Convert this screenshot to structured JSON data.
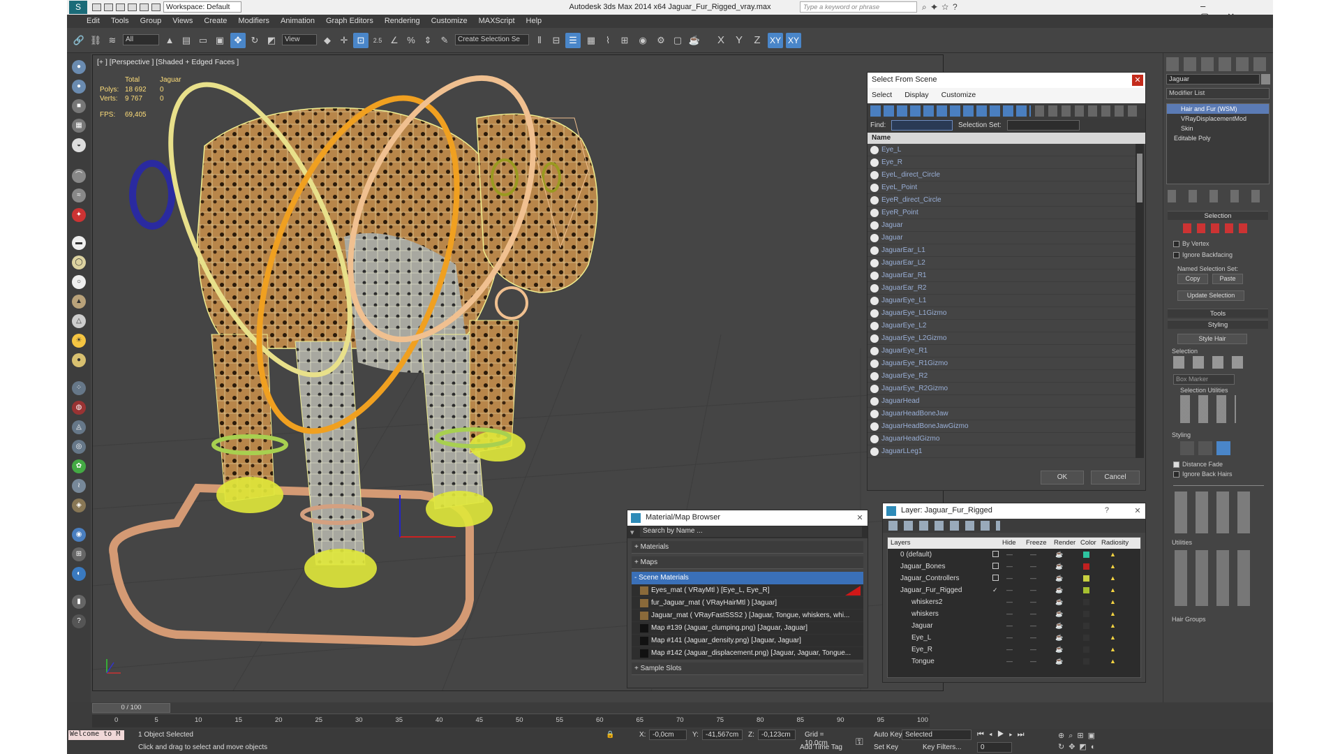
{
  "window": {
    "title": "Autodesk 3ds Max  2014 x64    Jaguar_Fur_Rigged_vray.max",
    "workspace": "Workspace: Default",
    "search_placeholder": "Type a keyword or phrase"
  },
  "menu": [
    "Edit",
    "Tools",
    "Group",
    "Views",
    "Create",
    "Modifiers",
    "Animation",
    "Graph Editors",
    "Rendering",
    "Customize",
    "MAXScript",
    "Help"
  ],
  "toolbar": {
    "filter": "All",
    "ref_coord": "View",
    "sel_set": "Create Selection Se",
    "axes": [
      "X",
      "Y",
      "Z",
      "XY",
      "XY"
    ],
    "snap_25": "2.5"
  },
  "viewport": {
    "label": "[+ ] [Perspective ] [Shaded + Edged Faces ]",
    "stats": {
      "total_label": "Total",
      "object_label": "Jaguar",
      "polys_label": "Polys:",
      "polys_total": "18 692",
      "polys_obj": "0",
      "verts_label": "Verts:",
      "verts_total": "9 767",
      "verts_obj": "0",
      "fps_label": "FPS:",
      "fps_value": "69,405"
    }
  },
  "select_from_scene": {
    "title": "Select From Scene",
    "menus": [
      "Select",
      "Display",
      "Customize"
    ],
    "find_label": "Find:",
    "selset_label": "Selection Set:",
    "col_name": "Name",
    "items": [
      "Eye_L",
      "Eye_R",
      "EyeL_direct_Circle",
      "EyeL_Point",
      "EyeR_direct_Circle",
      "EyeR_Point",
      "Jaguar",
      "Jaguar",
      "JaguarEar_L1",
      "JaguarEar_L2",
      "JaguarEar_R1",
      "JaguarEar_R2",
      "JaguarEye_L1",
      "JaguarEye_L1Gizmo",
      "JaguarEye_L2",
      "JaguarEye_L2Gizmo",
      "JaguarEye_R1",
      "JaguarEye_R1Gizmo",
      "JaguarEye_R2",
      "JaguarEye_R2Gizmo",
      "JaguarHead",
      "JaguarHeadBoneJaw",
      "JaguarHeadBoneJawGizmo",
      "JaguarHeadGizmo",
      "JaguarLLeg1"
    ],
    "ok": "OK",
    "cancel": "Cancel"
  },
  "material_browser": {
    "title": "Material/Map Browser",
    "search_placeholder": "Search by Name ...",
    "groups": [
      "+ Materials",
      "+ Maps",
      "- Scene Materials"
    ],
    "rows": [
      "Eyes_mat  ( VRayMtl )  [Eye_L, Eye_R]",
      "fur_Jaguar_mat  ( VRayHairMtl )  [Jaguar]",
      "Jaguar_mat  ( VRayFastSSS2 )  [Jaguar, Tongue, whiskers, whi...",
      "Map #139 (Jaguar_clumping.png)  [Jaguar, Jaguar]",
      "Map #141 (Jaguar_density.png)  [Jaguar, Jaguar]",
      "Map #142 (Jaguar_displacement.png)  [Jaguar, Jaguar, Tongue..."
    ],
    "sample_slots": "+ Sample Slots"
  },
  "layer_dialog": {
    "title": "Layer: Jaguar_Fur_Rigged",
    "help": "?",
    "cols": [
      "Layers",
      "Hide",
      "Freeze",
      "Render",
      "Color",
      "Radiosity"
    ],
    "rows": [
      "0 (default)",
      "Jaguar_Bones",
      "Jaguar_Controllers",
      "Jaguar_Fur_Rigged",
      "whiskers2",
      "whiskers",
      "Jaguar",
      "Eye_L",
      "Eye_R",
      "Tongue"
    ],
    "colors": [
      "#2ec4a0",
      "#c02020",
      "#c8d040",
      "#a6c030",
      "#333333",
      "#333333",
      "#333333",
      "#333333",
      "#333333",
      "#333333"
    ]
  },
  "command_panel": {
    "object_name": "Jaguar",
    "modifier_list": "Modifier List",
    "stack": [
      "Hair and Fur (WSM)",
      "VRayDisplacementMod",
      "Skin",
      "Editable Poly"
    ],
    "selection_roll": "Selection",
    "by_vertex": "By Vertex",
    "ignore_backfacing": "Ignore Backfacing",
    "named_sel": "Named Selection Set:",
    "copy": "Copy",
    "paste": "Paste",
    "update_sel": "Update Selection",
    "tools_roll": "Tools",
    "styling_roll": "Styling",
    "style_hair": "Style Hair",
    "selection_sub": "Selection",
    "box_marker": "Box Marker",
    "sel_utilities": "Selection Utilities",
    "styling_sub": "Styling",
    "distance_fade": "Distance Fade",
    "ignore_back_hairs": "Ignore Back Hairs",
    "utilities_sub": "Utilities",
    "hair_groups": "Hair Groups"
  },
  "timeline": {
    "frame": "0 / 100",
    "ticks": [
      "0",
      "5",
      "10",
      "15",
      "20",
      "25",
      "30",
      "35",
      "40",
      "45",
      "50",
      "55",
      "60",
      "65",
      "70",
      "75",
      "80",
      "85",
      "90",
      "95",
      "100"
    ]
  },
  "status": {
    "maxscript": "Welcome to M",
    "selected": "1 Object Selected",
    "prompt": "Click and drag to select and move objects",
    "x_label": "X:",
    "x": "-0,0cm",
    "y_label": "Y:",
    "y": "-41,567cm",
    "z_label": "Z:",
    "z": "-0,123cm",
    "grid": "Grid = 10,0cm",
    "auto_key": "Auto Key",
    "selected_dd": "Selected",
    "set_key": "Set Key",
    "key_filters": "Key Filters...",
    "add_time_tag": "Add Time Tag",
    "frame_field": "0"
  }
}
